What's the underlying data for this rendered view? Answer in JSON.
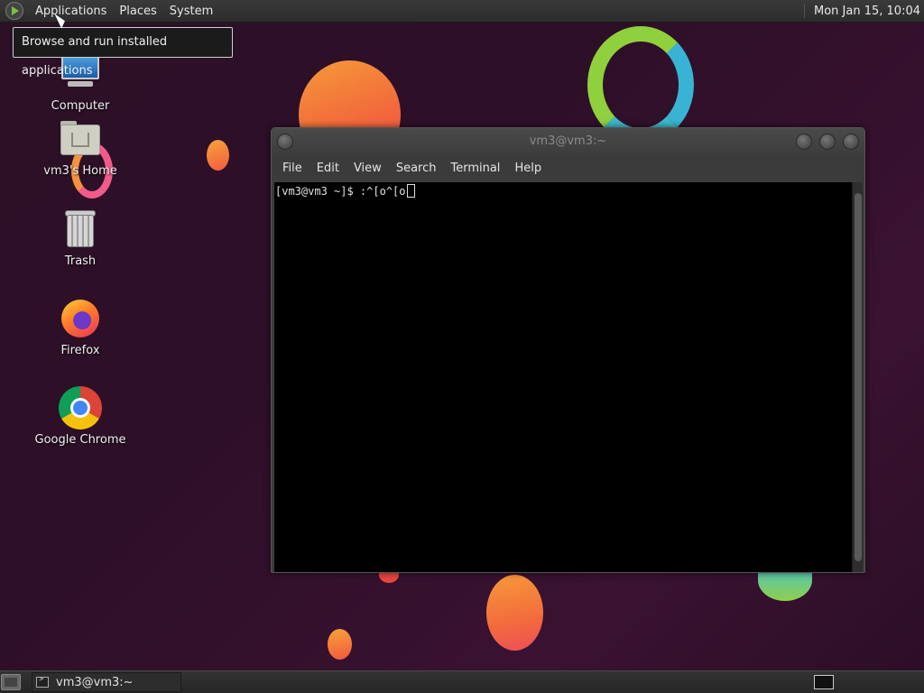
{
  "top_panel": {
    "menus": [
      "Applications",
      "Places",
      "System"
    ],
    "clock": "Mon Jan 15, 10:04"
  },
  "tooltip": "Browse and run installed applications",
  "desktop_icons": [
    {
      "label": "Computer",
      "icon": "computer-icon"
    },
    {
      "label": "vm3's Home",
      "icon": "home-folder-icon"
    },
    {
      "label": "Trash",
      "icon": "trash-icon"
    },
    {
      "label": "Firefox",
      "icon": "firefox-icon"
    },
    {
      "label": "Google Chrome",
      "icon": "chrome-icon"
    }
  ],
  "terminal": {
    "title": "vm3@vm3:~",
    "menus": [
      "File",
      "Edit",
      "View",
      "Search",
      "Terminal",
      "Help"
    ],
    "prompt_line": "[vm3@vm3 ~]$ :^[o^[o"
  },
  "bottom_panel": {
    "task_label": "vm3@vm3:~"
  },
  "colors": {
    "desktop_bg": "#2e0f28",
    "terminal_bg": "#000000",
    "panel_bg": "#2c2c2c"
  }
}
